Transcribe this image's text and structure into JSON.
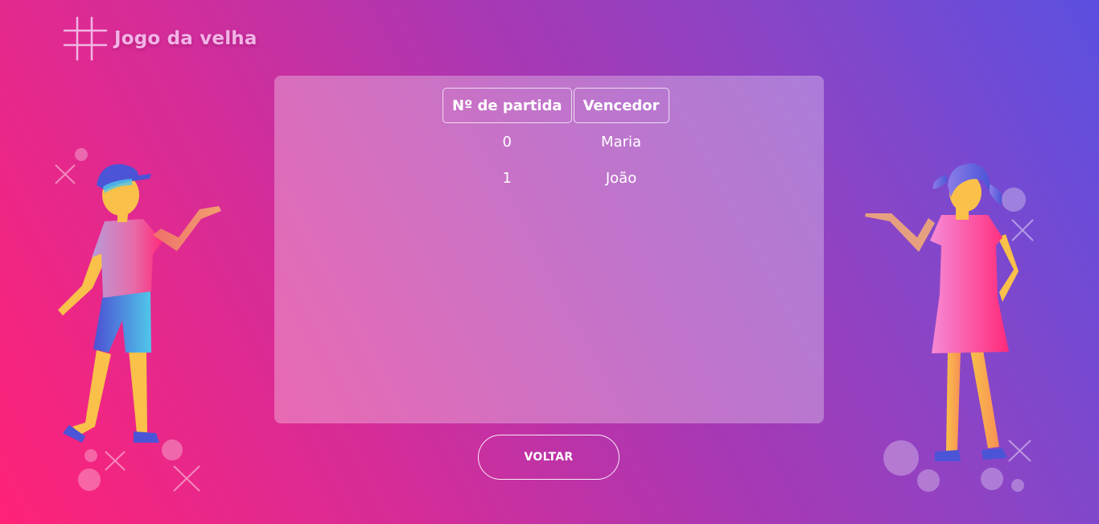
{
  "header": {
    "title": "Jogo da velha",
    "logo_icon": "hash-grid-icon"
  },
  "history_table": {
    "columns": [
      "Nº de partida",
      "Vencedor"
    ],
    "rows": [
      {
        "match": "0",
        "winner": "Maria"
      },
      {
        "match": "1",
        "winner": "João"
      }
    ]
  },
  "actions": {
    "back_label": "VOLTAR"
  },
  "illustrations": {
    "left": "boy-with-cap-illustration",
    "right": "girl-in-dress-illustration"
  },
  "colors": {
    "background_start": "#ff2277",
    "background_end": "#5b4fe0",
    "title": "#f1b4e6",
    "skin": "#f9c04a",
    "accent_blue": "#4b54d6"
  }
}
